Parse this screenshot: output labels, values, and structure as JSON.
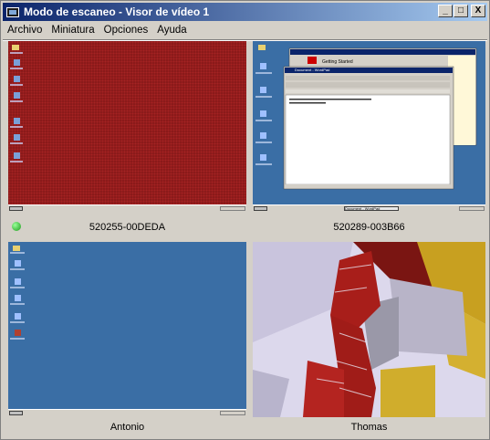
{
  "window": {
    "title": "Modo de escaneo - Visor de vídeo 1",
    "min_label": "_",
    "max_label": "□",
    "close_label": "X"
  },
  "menu": {
    "items": [
      "Archivo",
      "Miniatura",
      "Opciones",
      "Ayuda"
    ]
  },
  "thumbnails": [
    {
      "caption": "520255-00DEDA",
      "status": "connected"
    },
    {
      "caption": "520289-003B66"
    },
    {
      "caption": "Antonio"
    },
    {
      "caption": "Thomas"
    }
  ],
  "remote_desktop_2": {
    "dialog_title": "Getting Started",
    "wordpad_title": "Document - WordPad",
    "taskbar_item": "Document - WordPad"
  },
  "colors": {
    "titlebar": "#0a246a",
    "desktop_red": "#8b1a1a",
    "desktop_blue": "#3a6ea5",
    "status_green": "#1a9a1a"
  }
}
